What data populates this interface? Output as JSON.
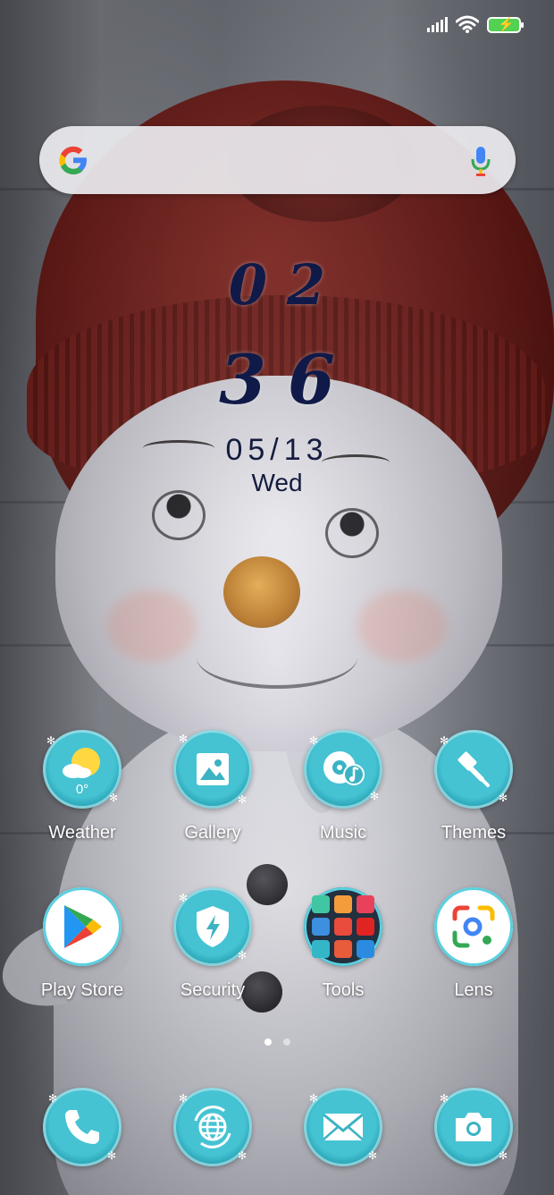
{
  "status_bar": {
    "signal_icon": "signal-bars-icon",
    "wifi_icon": "wifi-icon",
    "battery_icon": "battery-charging-icon",
    "battery_color": "#52d152"
  },
  "search": {
    "logo_icon": "google-g-icon",
    "mic_icon": "microphone-icon",
    "placeholder": ""
  },
  "clock": {
    "hour": "02",
    "minute": "36",
    "date": "05/13",
    "day": "Wed",
    "color": "#101a48"
  },
  "apps": {
    "row1": [
      {
        "label": "Weather",
        "icon": "weather-sun-cloud-icon",
        "badge": "0°"
      },
      {
        "label": "Gallery",
        "icon": "gallery-image-icon"
      },
      {
        "label": "Music",
        "icon": "music-disc-icon"
      },
      {
        "label": "Themes",
        "icon": "paintbrush-icon"
      }
    ],
    "row2": [
      {
        "label": "Play Store",
        "icon": "play-store-icon"
      },
      {
        "label": "Security",
        "icon": "shield-bolt-icon"
      },
      {
        "label": "Tools",
        "icon": "tools-folder-icon"
      },
      {
        "label": "Lens",
        "icon": "google-lens-icon"
      }
    ]
  },
  "dock": [
    {
      "icon": "phone-icon"
    },
    {
      "icon": "browser-globe-icon"
    },
    {
      "icon": "messages-envelope-icon"
    },
    {
      "icon": "camera-icon"
    }
  ],
  "page_indicator": {
    "count": 2,
    "active": 1
  },
  "theme": {
    "icon_teal": "#46c3d3",
    "label_color": "#ffffff"
  }
}
